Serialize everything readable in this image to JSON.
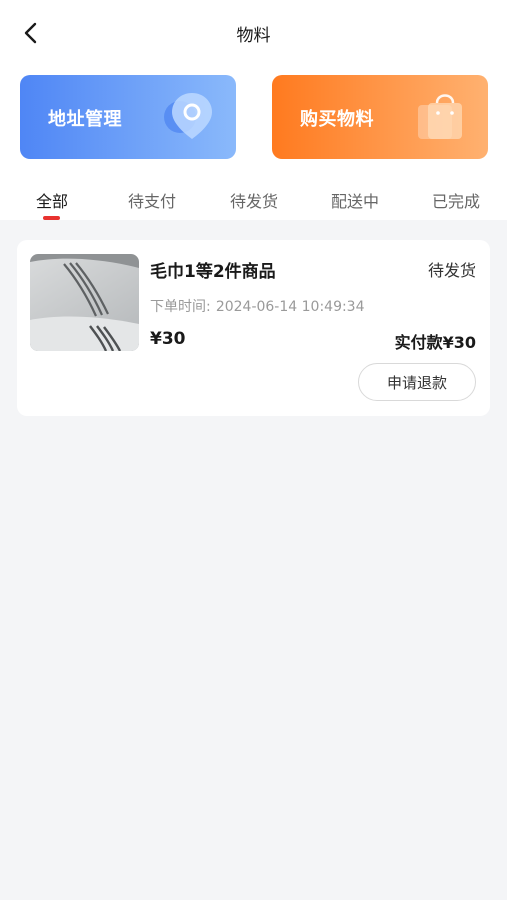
{
  "header": {
    "title": "物料",
    "back_icon": "chevron-left-icon"
  },
  "banners": {
    "address": {
      "label": "地址管理",
      "icon": "location-pin-icon",
      "color": "#4f86f5"
    },
    "buy": {
      "label": "购买物料",
      "icon": "shopping-bag-icon",
      "color": "#ff7a1f"
    }
  },
  "tabs": [
    {
      "label": "全部",
      "active": true
    },
    {
      "label": "待支付",
      "active": false
    },
    {
      "label": "待发货",
      "active": false
    },
    {
      "label": "配送中",
      "active": false
    },
    {
      "label": "已完成",
      "active": false
    }
  ],
  "colors": {
    "accent_indicator": "#e8322f",
    "background": "#f4f5f7"
  },
  "orders": [
    {
      "product_name": "毛巾1等2件商品",
      "status": "待发货",
      "time_label": "下单时间:",
      "time_value": "2024-06-14 10:49:34",
      "price": "¥30",
      "paid_label": "实付款¥30",
      "refund_button": "申请退款",
      "image": "towel-image"
    }
  ]
}
